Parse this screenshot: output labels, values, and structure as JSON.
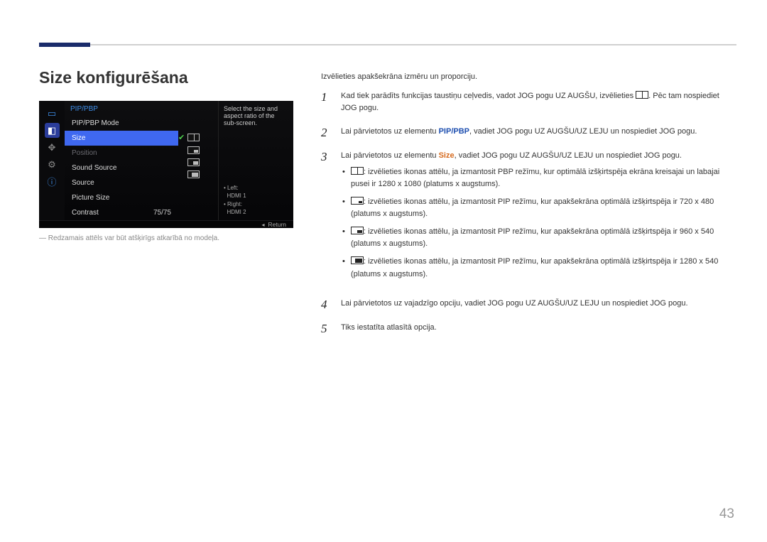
{
  "page_title": "Size konfigurēšana",
  "osd": {
    "header": "PIP/PBP",
    "items": {
      "mode": "PIP/PBP Mode",
      "size": "Size",
      "position": "Position",
      "sound_source": "Sound Source",
      "source": "Source",
      "picture_size": "Picture Size",
      "contrast": "Contrast"
    },
    "contrast_value": "75/75",
    "help_text": "Select the size and aspect ratio of the sub-screen.",
    "legend_left_label": "Left:",
    "legend_left_value": "HDMI 1",
    "legend_right_label": "Right:",
    "legend_right_value": "HDMI 2",
    "footer_return": "Return"
  },
  "caption": "Redzamais attēls var būt atšķirīgs atkarībā no modeļa.",
  "intro": "Izvēlieties apakšekrāna izmēru un proporciju.",
  "steps": {
    "s1_a": "Kad tiek parādīts funkcijas taustiņu ceļvedis, vadot JOG pogu UZ AUGŠU, izvēlieties ",
    "s1_b": ". Pēc tam nospiediet JOG pogu.",
    "s2_a": "Lai pārvietotos uz elementu ",
    "s2_hl": "PIP/PBP",
    "s2_b": ", vadiet JOG pogu UZ AUGŠU/UZ LEJU un nospiediet JOG pogu.",
    "s3_a": "Lai pārvietotos uz elementu ",
    "s3_hl": "Size",
    "s3_b": ", vadiet JOG pogu UZ AUGŠU/UZ LEJU un nospiediet JOG pogu.",
    "s3_bullet_text": ": izvēlieties ikonas attēlu, ja izmantosit PBP režīmu, kur optimālā izšķirtspēja ekrāna kreisajai un labajai pusei ir 1280 x 1080 (platums x augstums).",
    "s3_bullet2_text": ": izvēlieties ikonas attēlu, ja izmantosit PIP režīmu, kur apakšekrāna optimālā izšķirtspēja ir 720 x 480 (platums x augstums).",
    "s3_bullet3_text": ": izvēlieties ikonas attēlu, ja izmantosit PIP režīmu, kur apakšekrāna optimālā izšķirtspēja ir 960 x 540 (platums x augstums).",
    "s3_bullet4_text": ": izvēlieties ikonas attēlu, ja izmantosit PIP režīmu, kur apakšekrāna optimālā izšķirtspēja ir 1280 x 540 (platums x augstums).",
    "s4": "Lai pārvietotos uz vajadzīgo opciju, vadiet JOG pogu UZ AUGŠU/UZ LEJU un nospiediet JOG pogu.",
    "s5": "Tiks iestatīta atlasītā opcija."
  },
  "page_number": "43"
}
